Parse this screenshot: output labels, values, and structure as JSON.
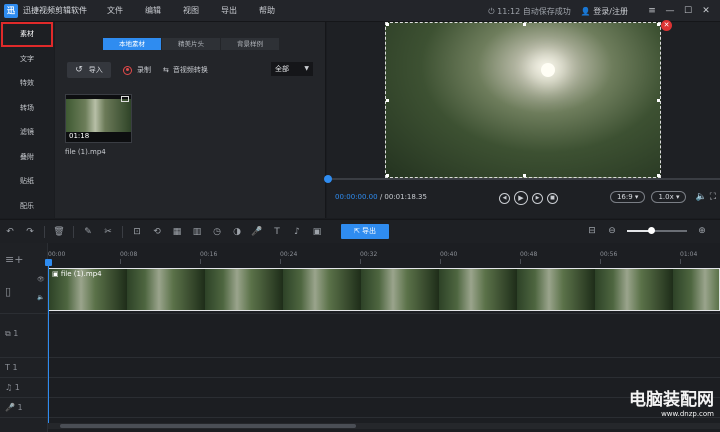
{
  "app": {
    "title": "迅捷视频剪辑软件",
    "logo": "迅",
    "menu": [
      "文件",
      "编辑",
      "视图",
      "导出",
      "帮助"
    ],
    "autosave_status": "11:12 自动保存成功",
    "login": "登录/注册"
  },
  "sidebar": {
    "items": [
      {
        "label": "素材",
        "active": true
      },
      {
        "label": "文字"
      },
      {
        "label": "特效"
      },
      {
        "label": "转场"
      },
      {
        "label": "滤镜"
      },
      {
        "label": "叠附"
      },
      {
        "label": "贴纸"
      },
      {
        "label": "配乐"
      }
    ]
  },
  "media": {
    "tabs": [
      "本地素材",
      "精美片头",
      "背景样例"
    ],
    "active_tab": 0,
    "import_label": "导入",
    "record_label": "录制",
    "convert_label": "音视频转换",
    "filter_value": "全部",
    "items": [
      {
        "name": "file (1).mp4",
        "duration": "01:18"
      }
    ]
  },
  "preview": {
    "current_time": "00:00:00.00",
    "total_time": "/ 00:01:18.35",
    "aspect": "16:9",
    "speed": "1.0x",
    "progress": 0
  },
  "toolbar": {
    "export_label": "导出",
    "zoom_level": 0.4
  },
  "timeline": {
    "ticks": [
      "00:00",
      "00:08",
      "00:16",
      "00:24",
      "00:32",
      "00:40",
      "00:48",
      "00:56",
      "01:04"
    ],
    "clip_label": "file (1).mp4",
    "track_counts": [
      "1",
      "1",
      "1"
    ]
  },
  "watermark": {
    "title": "电脑装配网",
    "url": "www.dnzp.com"
  },
  "colors": {
    "accent": "#2f8cf0",
    "highlight": "#e02a2a"
  }
}
